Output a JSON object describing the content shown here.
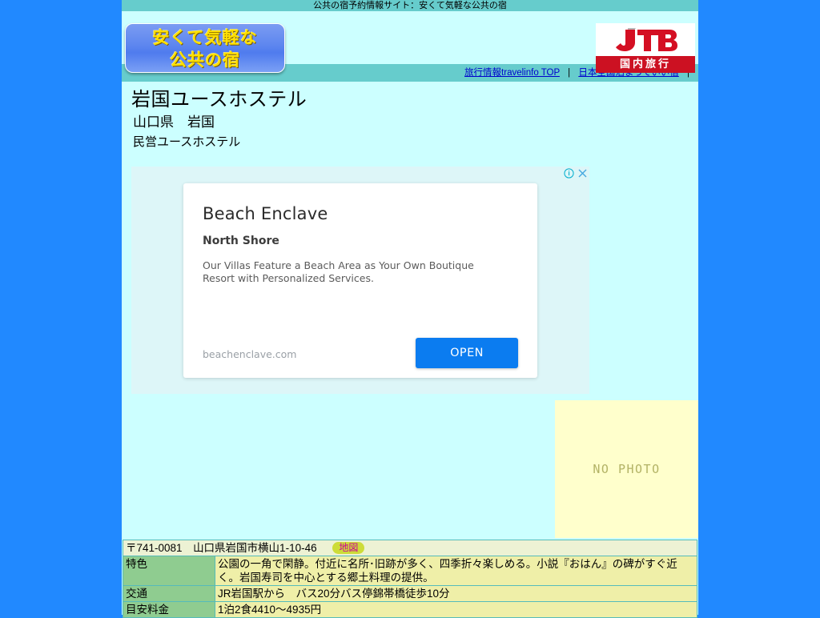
{
  "site": {
    "title_bar": "公共の宿予約情報サイト：安くて気軽な公共の宿",
    "logo_line1": "安くて気軽な",
    "logo_line2": "公共の宿",
    "sponsor_mark": "JTB",
    "sponsor_sub": "国内旅行"
  },
  "nav": {
    "link1": "旅行情報travelinfo TOP",
    "sep1": "|",
    "link2": "日本全国泊まっていい宿",
    "sep2": "|"
  },
  "hotel": {
    "name": "岩国ユースホステル",
    "region": "山口県　岩国",
    "type": "民営ユースホステル"
  },
  "ad": {
    "title": "Beach Enclave",
    "subtitle": "North Shore",
    "body": "Our Villas Feature a Beach Area as Your Own Boutique Resort with Personalized Services.",
    "url": "beachenclave.com",
    "button": "OPEN",
    "info_icon": "info-icon",
    "close_icon": "close-icon"
  },
  "photo": {
    "placeholder": "NO PHOTO"
  },
  "address": {
    "postal_mark": "〒",
    "postal_code": "741-0081",
    "text": "山口県岩国市横山1-10-46",
    "map_label": "地図"
  },
  "table": {
    "rows": [
      {
        "label": "特色",
        "value": "公園の一角で閑静。付近に名所･旧跡が多く、四季折々楽しめる。小説『おはん』の碑がすぐ近く。岩国寿司を中心とする郷土料理の提供。"
      },
      {
        "label": "交通",
        "value": "JR岩国駅から　バス20分バス停錦帯橋徒歩10分"
      },
      {
        "label": "目安料金",
        "value": "1泊2食4410〜4935円"
      }
    ]
  },
  "colors": {
    "outer_background": "#2189ff",
    "title_bar": "#66cccc",
    "content_background": "#ccffff",
    "nav_bar": "#66cccc",
    "table_header": "#8fcc90",
    "table_value": "#efefa8",
    "address_row": "#edf2d4",
    "map_badge": "#cddc39",
    "map_badge_text": "#cc0099",
    "ad_button": "#0b7cf0",
    "photo_placeholder": "#ffffcc"
  }
}
